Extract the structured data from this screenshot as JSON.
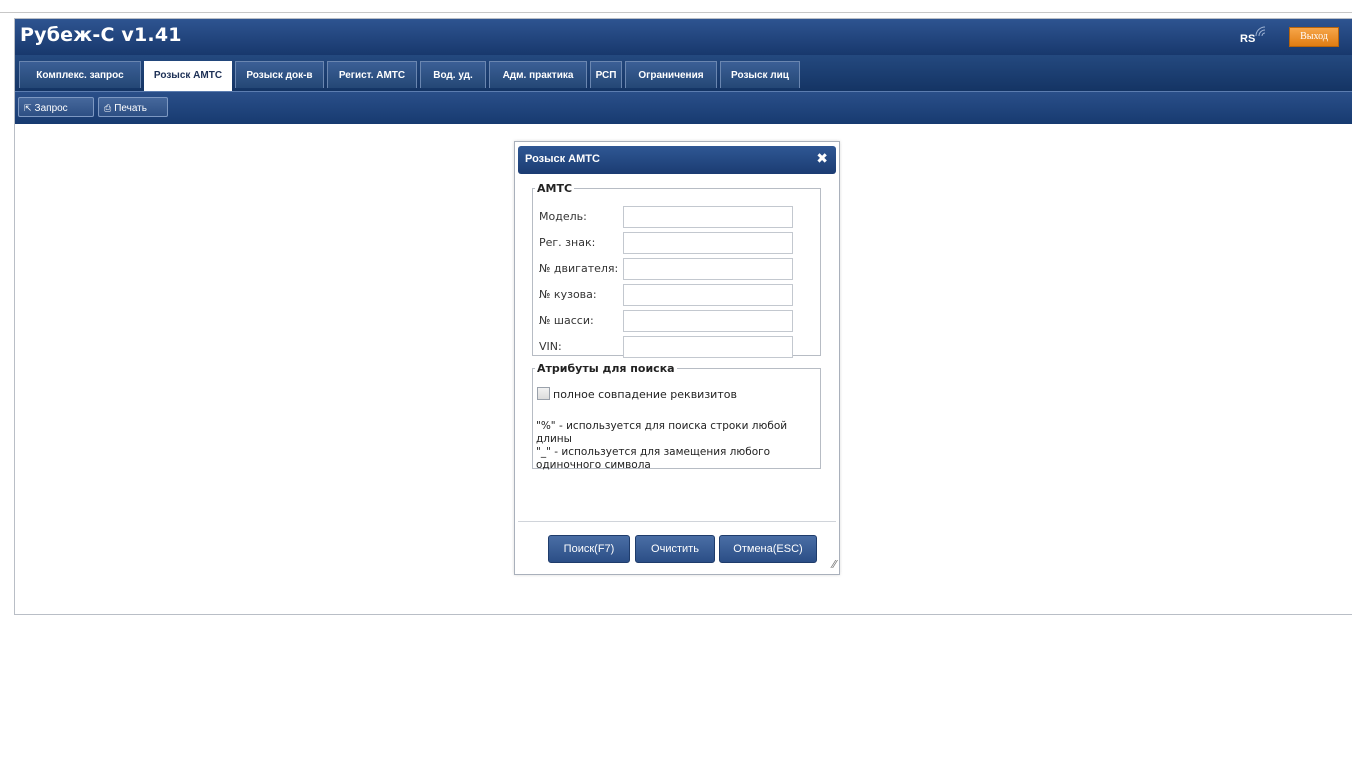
{
  "app": {
    "title": "Рубеж-С v1.41",
    "logo_text": "RS",
    "exit_label": "Выход"
  },
  "tabs": [
    {
      "label": "Комплекс. запрос",
      "active": false
    },
    {
      "label": "Розыск АМТС",
      "active": true
    },
    {
      "label": "Розыск док-в",
      "active": false
    },
    {
      "label": "Регист. АМТС",
      "active": false
    },
    {
      "label": "Вод. уд.",
      "active": false
    },
    {
      "label": "Адм. практика",
      "active": false
    },
    {
      "label": "РСП",
      "active": false
    },
    {
      "label": "Ограничения",
      "active": false
    },
    {
      "label": "Розыск лиц",
      "active": false
    }
  ],
  "toolbar": {
    "query_label": "Запрос",
    "query_icon": "query-icon",
    "print_label": "Печать",
    "print_icon": "printer-icon"
  },
  "dialog": {
    "title": "Розыск АМТС",
    "close_icon": "close-icon",
    "vehicle_group": {
      "legend": "АМТС",
      "fields": [
        {
          "label": "Модель:",
          "value": ""
        },
        {
          "label": "Рег. знак:",
          "value": ""
        },
        {
          "label": "№ двигателя:",
          "value": ""
        },
        {
          "label": "№ кузова:",
          "value": ""
        },
        {
          "label": "№ шасси:",
          "value": ""
        },
        {
          "label": "VIN:",
          "value": ""
        }
      ]
    },
    "search_attrs": {
      "legend": "Атрибуты для поиска",
      "exact_match_label": "полное совпадение реквизитов",
      "exact_match_checked": false,
      "hint_percent": "\"%\" - используется для поиска строки любой длины",
      "hint_underscore": "\"_\" - используется для замещения любого одиночного символа"
    },
    "buttons": {
      "search": "Поиск(F7)",
      "clear": "Очистить",
      "cancel": "Отмена(ESC)"
    }
  },
  "colors": {
    "header_blue": "#1b3c72",
    "exit_orange": "#f08d22",
    "button_blue": "#3a5d95"
  }
}
